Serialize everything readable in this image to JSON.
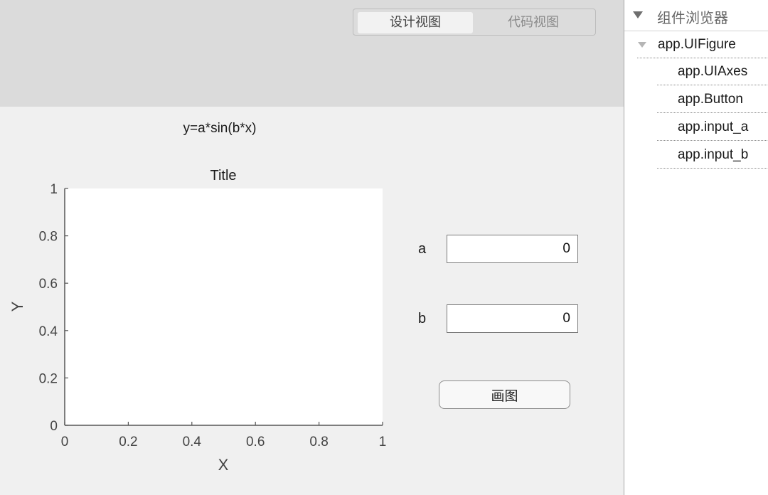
{
  "header": {
    "view_tabs": [
      {
        "label": "设计视图",
        "selected": true
      },
      {
        "label": "代码视图",
        "selected": false
      }
    ]
  },
  "canvas": {
    "formula_label": "y=a*sin(b*x)",
    "axes": {
      "title": "Title",
      "xlabel": "X",
      "ylabel": "Y",
      "x_ticks": [
        "0",
        "0.2",
        "0.4",
        "0.6",
        "0.8",
        "1"
      ],
      "y_ticks": [
        "0",
        "0.2",
        "0.4",
        "0.6",
        "0.8",
        "1"
      ],
      "xlim": [
        0,
        1
      ],
      "ylim": [
        0,
        1
      ]
    },
    "input_a": {
      "label": "a",
      "value": "0"
    },
    "input_b": {
      "label": "b",
      "value": "0"
    },
    "plot_button": {
      "label": "画图"
    }
  },
  "component_browser": {
    "title": "组件浏览器",
    "root": "app.UIFigure",
    "children": [
      "app.UIAxes",
      "app.Button",
      "app.input_a",
      "app.input_b"
    ]
  },
  "colors": {
    "header_bg": "#dbdbdb",
    "canvas_bg": "#f0f0f0",
    "axes_color": "#555555",
    "plot_bg": "#ffffff"
  }
}
